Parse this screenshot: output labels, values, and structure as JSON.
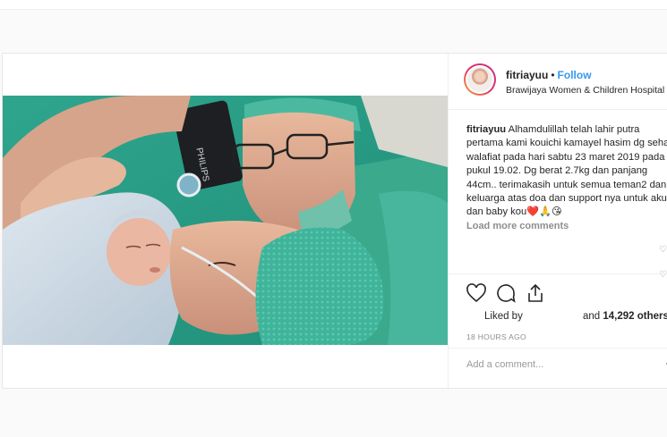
{
  "post": {
    "username": "fitriayuu",
    "separator": "•",
    "follow_label": "Follow",
    "location": "Brawijaya Women & Children Hospital",
    "caption_user": "fitriayuu",
    "caption_text": "Alhamdulillah telah lahir putra pertama kami kouichi kamayel hasim dg sehat walafiat pada hari sabtu 23 maret 2019 pada pukul 19.02. Dg berat 2.7kg dan panjang 44cm.. terimakasih untuk semua teman2 dan keluarga atas doa dan support nya untuk aku dan baby kou",
    "caption_emojis": "❤️🙏😘",
    "load_more": "Load more comments",
    "likes_prefix": "Liked by",
    "likes_suffix": "and",
    "likes_count": "14,292",
    "likes_others": "others",
    "timestamp": "18 HOURS AGO",
    "comment_placeholder": "Add a comment...",
    "more_label": "•",
    "photo_brand_text": "PHILIPS"
  },
  "icons": {
    "like": "heart-outline-icon",
    "comment": "speech-bubble-icon",
    "share": "share-icon",
    "save": "bookmark-icon",
    "comment_like": "small-heart-icon"
  },
  "colors": {
    "follow": "#3897f0",
    "muted": "#8e8e8e",
    "text": "#262626",
    "border": "#efefef"
  }
}
